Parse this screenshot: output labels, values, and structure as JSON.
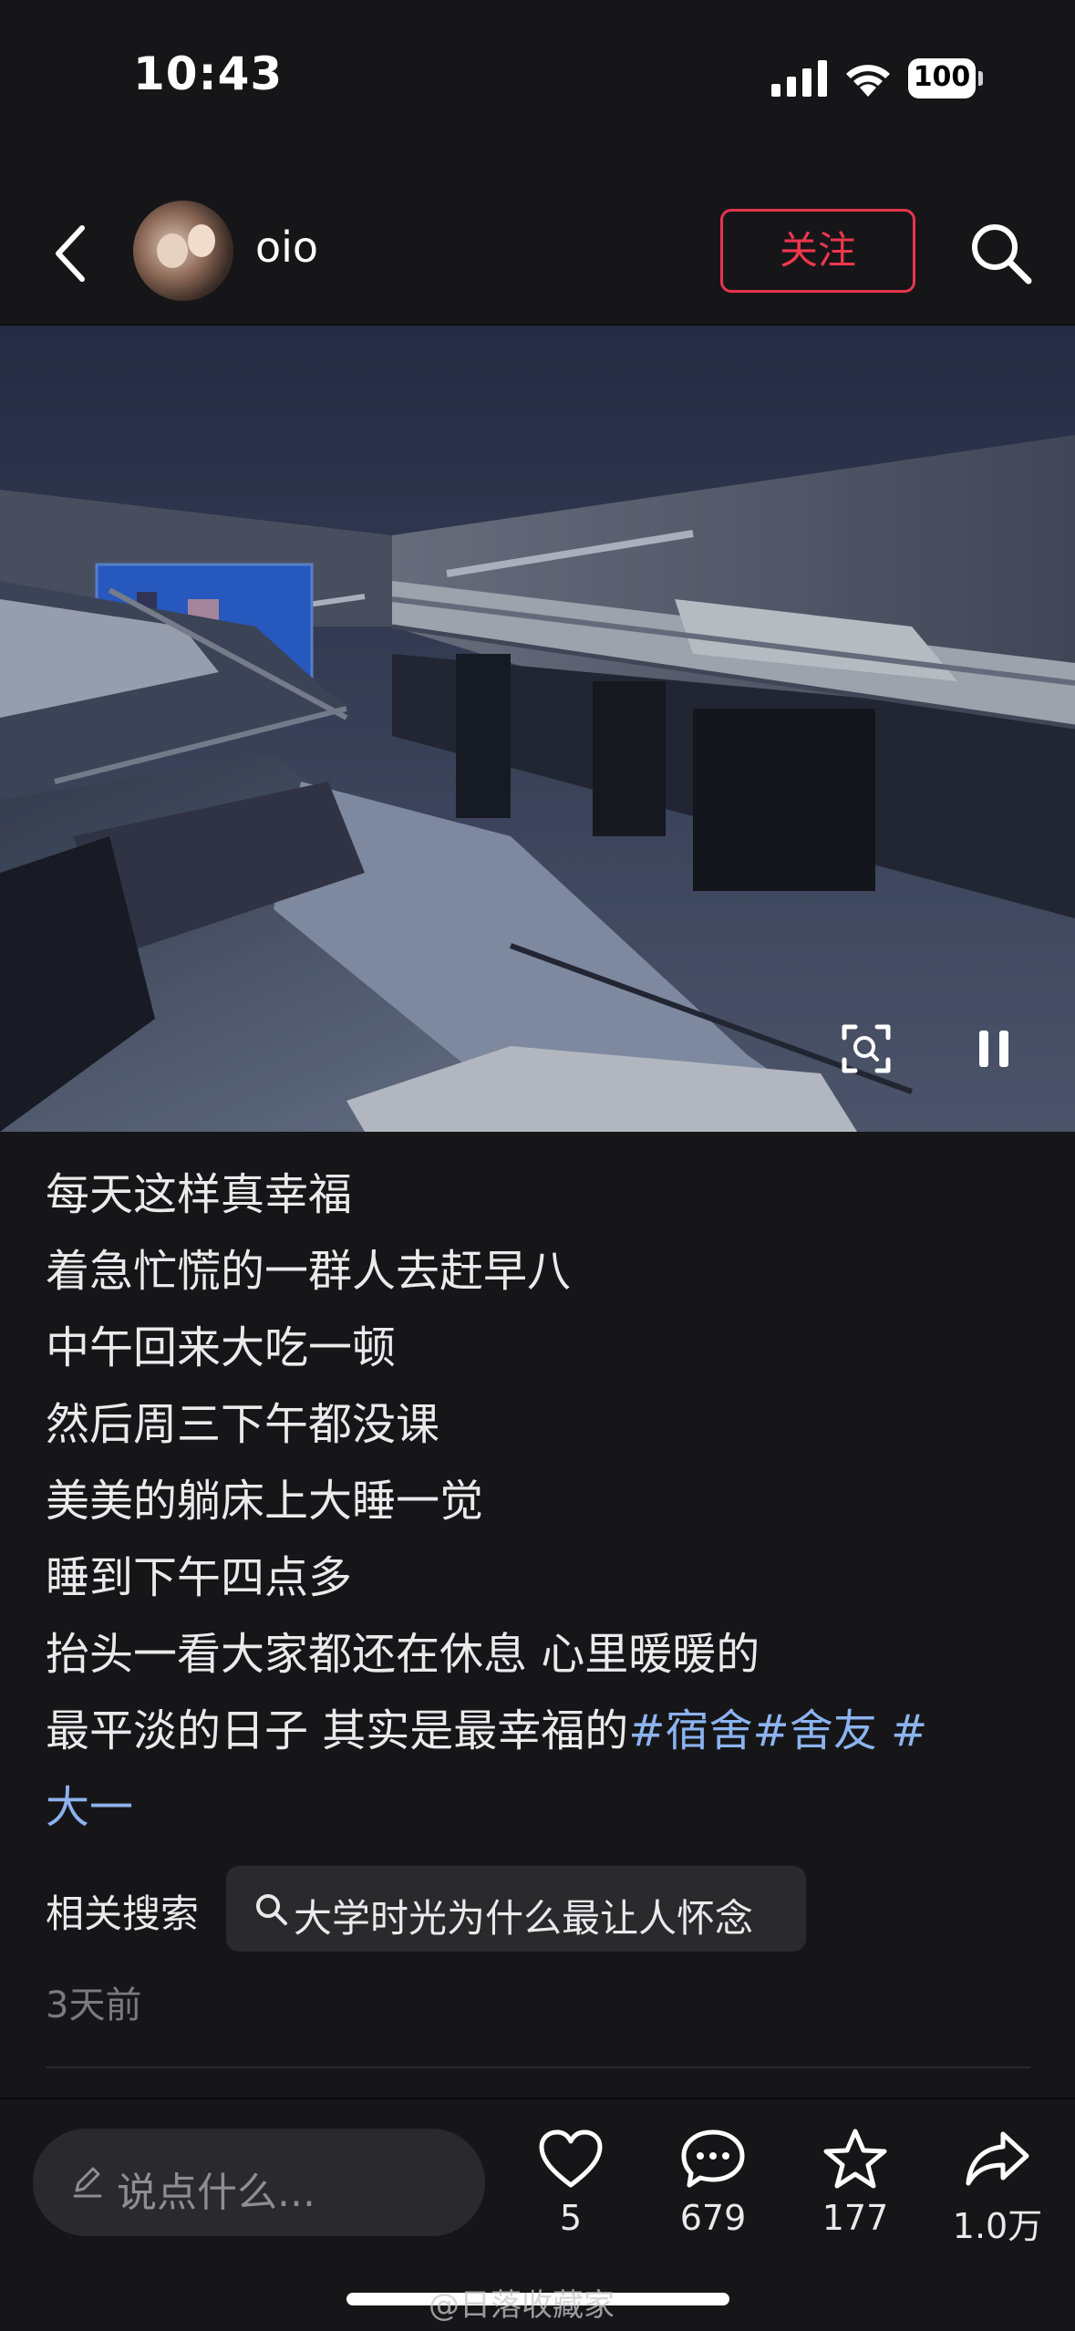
{
  "status_bar": {
    "time": "10:43",
    "battery": "100"
  },
  "header": {
    "username": "oio",
    "follow_label": "关注"
  },
  "post": {
    "caption_lines": [
      "每天这样真幸福",
      "着急忙慌的一群人去赶早八",
      "中午回来大吃一顿",
      "然后周三下午都没课",
      "美美的躺床上大睡一觉",
      "睡到下午四点多",
      "抬头一看大家都还在休息 心里暖暖的"
    ],
    "last_line_text": "最平淡的日子 其实是最幸福的",
    "hashtags": [
      "#宿舍",
      "#舍友",
      " #"
    ],
    "hashtag_continued": "大一",
    "related_label": "相关搜索",
    "related_query": "大学时光为什么最让人怀念",
    "posted_time": "3天前"
  },
  "bottom_bar": {
    "comment_placeholder": "说点什么...",
    "like_count": "5",
    "comment_count": "679",
    "favorite_count": "177",
    "share_count": "1.0万"
  },
  "watermark": "@日落收藏家",
  "colors": {
    "background": "#161618",
    "follow_red": "#e8344e",
    "hashtag_blue": "#8cb3f0"
  },
  "icons": [
    "back-icon",
    "search-icon",
    "scan-icon",
    "pause-icon",
    "pencil-icon",
    "heart-icon",
    "comment-icon",
    "star-icon",
    "share-icon"
  ]
}
